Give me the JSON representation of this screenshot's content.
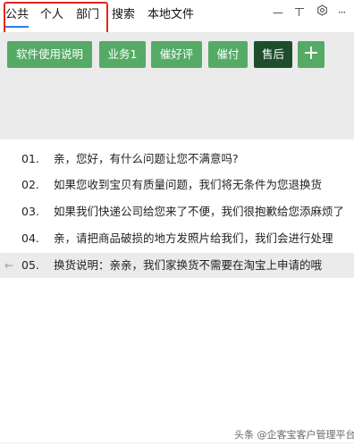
{
  "tabs": [
    {
      "label": "公共"
    },
    {
      "label": "个人"
    },
    {
      "label": "部门"
    },
    {
      "label": "搜索"
    },
    {
      "label": "本地文件"
    }
  ],
  "window_controls": {
    "minimize": "—",
    "more": "···"
  },
  "phrase_buttons": [
    {
      "label": "软件使用说明"
    },
    {
      "label": "业务1"
    },
    {
      "label": "催好评"
    },
    {
      "label": "催付"
    },
    {
      "label": "售后"
    },
    {
      "label": "+"
    }
  ],
  "phrases": [
    {
      "num": "01.",
      "text": "亲，您好，有什么问题让您不满意吗?"
    },
    {
      "num": "02.",
      "text": "如果您收到宝贝有质量问题，我们将无条件为您退换货"
    },
    {
      "num": "03.",
      "text": "如果我们快递公司给您来了不便，我们很抱歉给您添麻烦了"
    },
    {
      "num": "04.",
      "text": "亲，请把商品破损的地方发照片给我们，我们会进行处理"
    },
    {
      "num": "05.",
      "text": "换货说明：亲亲，我们家换货不需要在淘宝上申请的哦"
    }
  ],
  "arrow_glyph": "←",
  "watermark": "头条 @企客宝客户管理平台",
  "colors": {
    "accent_blue": "#2b7de9",
    "button_green": "#55ab66",
    "button_dark_green": "#1e4d2b",
    "highlight_red": "#e5251b"
  }
}
